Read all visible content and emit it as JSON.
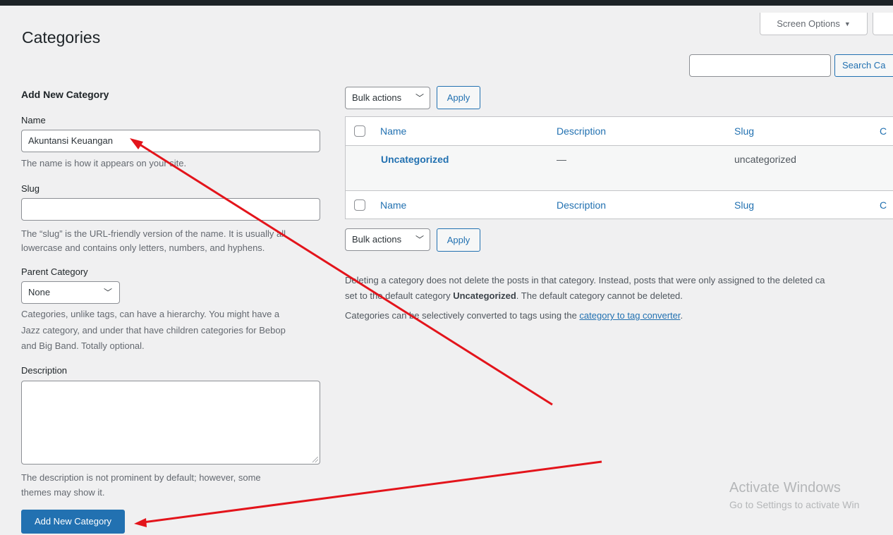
{
  "header": {
    "title": "Categories",
    "screen_options": "Screen Options",
    "search_button": "Search Ca"
  },
  "form": {
    "heading": "Add New Category",
    "name_label": "Name",
    "name_value": "Akuntansi Keuangan",
    "name_help": "The name is how it appears on your site.",
    "slug_label": "Slug",
    "slug_value": "",
    "slug_help_1": "The “slug” is the URL-friendly version of the name. It is usually all",
    "slug_help_2": "lowercase and contains only letters, numbers, and hyphens.",
    "parent_label": "Parent Category",
    "parent_selected": "None",
    "parent_help_1": "Categories, unlike tags, can have a hierarchy. You might have a",
    "parent_help_2": "Jazz category, and under that have children categories for Bebop",
    "parent_help_3": "and Big Band. Totally optional.",
    "description_label": "Description",
    "description_help_1": "The description is not prominent by default; however, some",
    "description_help_2": "themes may show it.",
    "submit_label": "Add New Category"
  },
  "list": {
    "bulk_actions": "Bulk actions",
    "apply": "Apply",
    "columns": [
      "Name",
      "Description",
      "Slug",
      "C"
    ],
    "rows": [
      {
        "name": "Uncategorized",
        "description": "—",
        "slug": "uncategorized"
      }
    ],
    "note_1_a": "Deleting a category does not delete the posts in that category. Instead, posts that were only assigned to the deleted ca",
    "note_1_b_pre": "set to the default category ",
    "note_1_b_bold": "Uncategorized",
    "note_1_b_post": ". The default category cannot be deleted.",
    "note_2_pre": "Categories can be selectively converted to tags using the ",
    "note_2_link": "category to tag converter",
    "note_2_post": "."
  },
  "watermark": {
    "title": "Activate Windows",
    "subtitle": "Go to Settings to activate Win"
  },
  "annotation_color": "#e3141b"
}
